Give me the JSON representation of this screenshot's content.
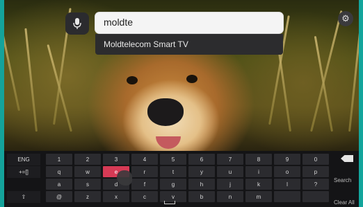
{
  "search": {
    "query": "moldte",
    "suggestion": "Moldtelecom Smart TV"
  },
  "keyboard": {
    "lang_label": "ENG",
    "symbols_label": "+=[]",
    "shift_label": "⇧",
    "rows": [
      [
        "1",
        "2",
        "3",
        "4",
        "5",
        "6",
        "7",
        "8",
        "9",
        "0"
      ],
      [
        "q",
        "w",
        "e",
        "r",
        "t",
        "y",
        "u",
        "i",
        "o",
        "p"
      ],
      [
        "a",
        "s",
        "d",
        "f",
        "g",
        "h",
        "j",
        "k",
        "l",
        "?"
      ],
      [
        "@",
        "z",
        "x",
        "c",
        "v",
        "b",
        "n",
        "m",
        "",
        ""
      ]
    ],
    "active_key": "e",
    "search_label": "Search",
    "clear_label": "Clear All"
  },
  "icons": {
    "mic": "microphone-icon",
    "settings": "gear-icon",
    "backspace": "backspace-icon",
    "space": "space-icon",
    "pointer": "hand-pointer-icon"
  },
  "colors": {
    "accent": "#d63a55",
    "frame": "#14a39b"
  }
}
